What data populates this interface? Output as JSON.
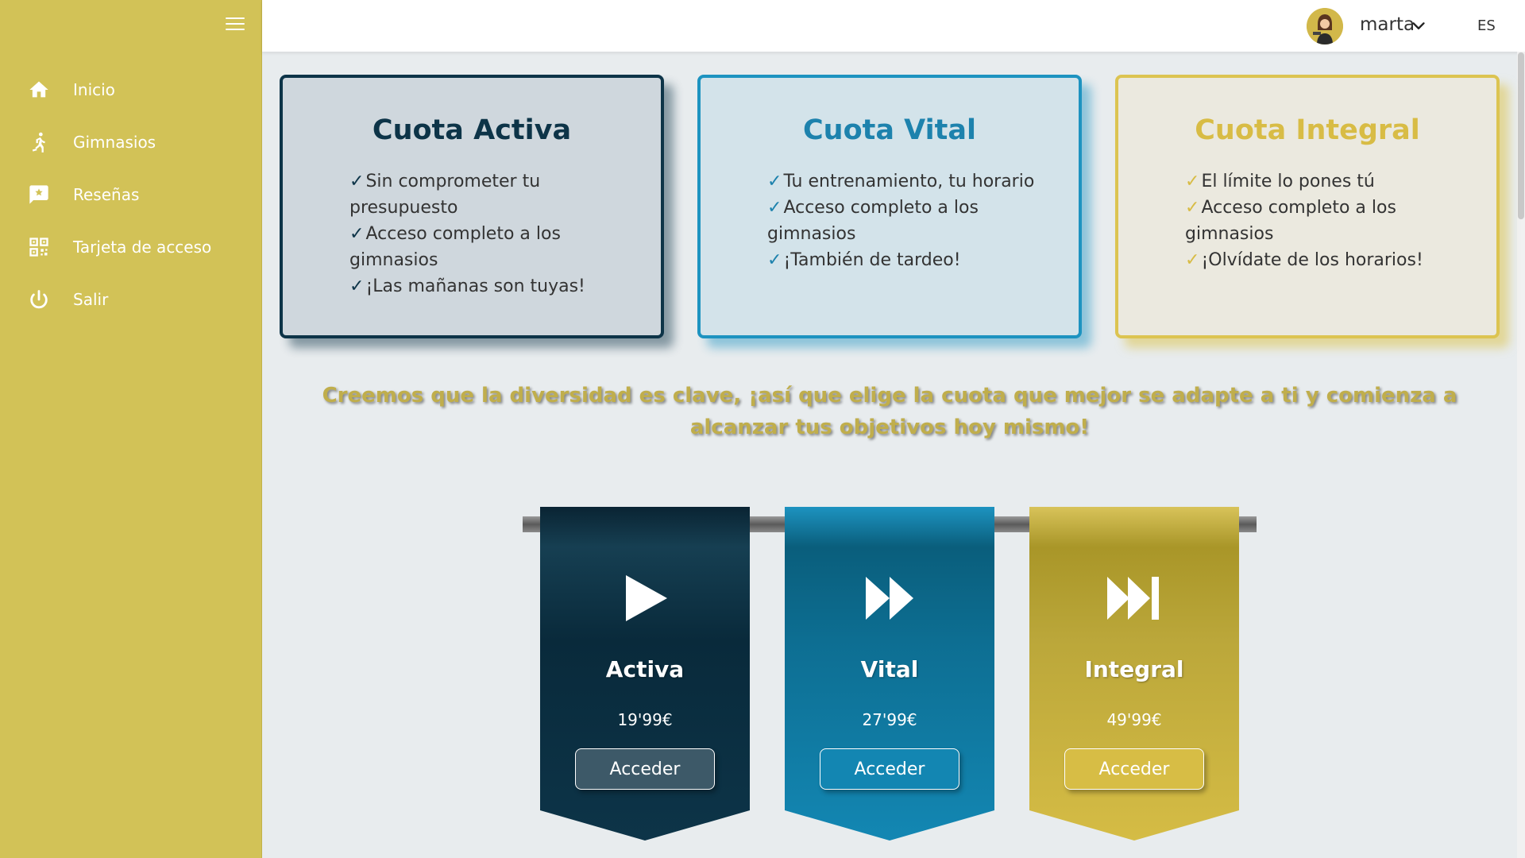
{
  "sidebar": {
    "items": [
      {
        "label": "Inicio",
        "icon": "home-icon"
      },
      {
        "label": "Gimnasios",
        "icon": "runner-icon"
      },
      {
        "label": "Reseñas",
        "icon": "review-icon"
      },
      {
        "label": "Tarjeta de acceso",
        "icon": "qr-code-icon"
      },
      {
        "label": "Salir",
        "icon": "power-icon"
      }
    ]
  },
  "topbar": {
    "username": "marta",
    "language": "ES"
  },
  "cards": {
    "activa": {
      "title": "Cuota Activa",
      "features": [
        "Sin comprometer tu presupuesto",
        "Acceso completo a los gimnasios",
        "¡Las mañanas son tuyas!"
      ]
    },
    "vital": {
      "title": "Cuota Vital",
      "features": [
        "Tu entrenamiento, tu horario",
        "Acceso completo a los gimnasios",
        "¡También de tardeo!"
      ]
    },
    "integral": {
      "title": "Cuota Integral",
      "features": [
        "El límite lo pones tú",
        "Acceso completo a los gimnasios",
        "¡Olvídate de los horarios!"
      ]
    }
  },
  "tick": "✓",
  "slogan": "Creemos que la diversidad es clave, ¡así que elige la cuota que mejor se adapte a ti y comienza a alcanzar tus objetivos hoy mismo!",
  "banners": {
    "activa": {
      "name": "Activa",
      "price": "19'99€",
      "button": "Acceder",
      "icon": "play-icon"
    },
    "vital": {
      "name": "Vital",
      "price": "27'99€",
      "button": "Acceder",
      "icon": "fast-forward-icon"
    },
    "integral": {
      "name": "Integral",
      "price": "49'99€",
      "button": "Acceder",
      "icon": "skip-forward-icon"
    }
  },
  "colors": {
    "sidebar": "#d2c257",
    "activa": "#0d3448",
    "vital": "#1d93c0",
    "integral": "#dcc451"
  }
}
